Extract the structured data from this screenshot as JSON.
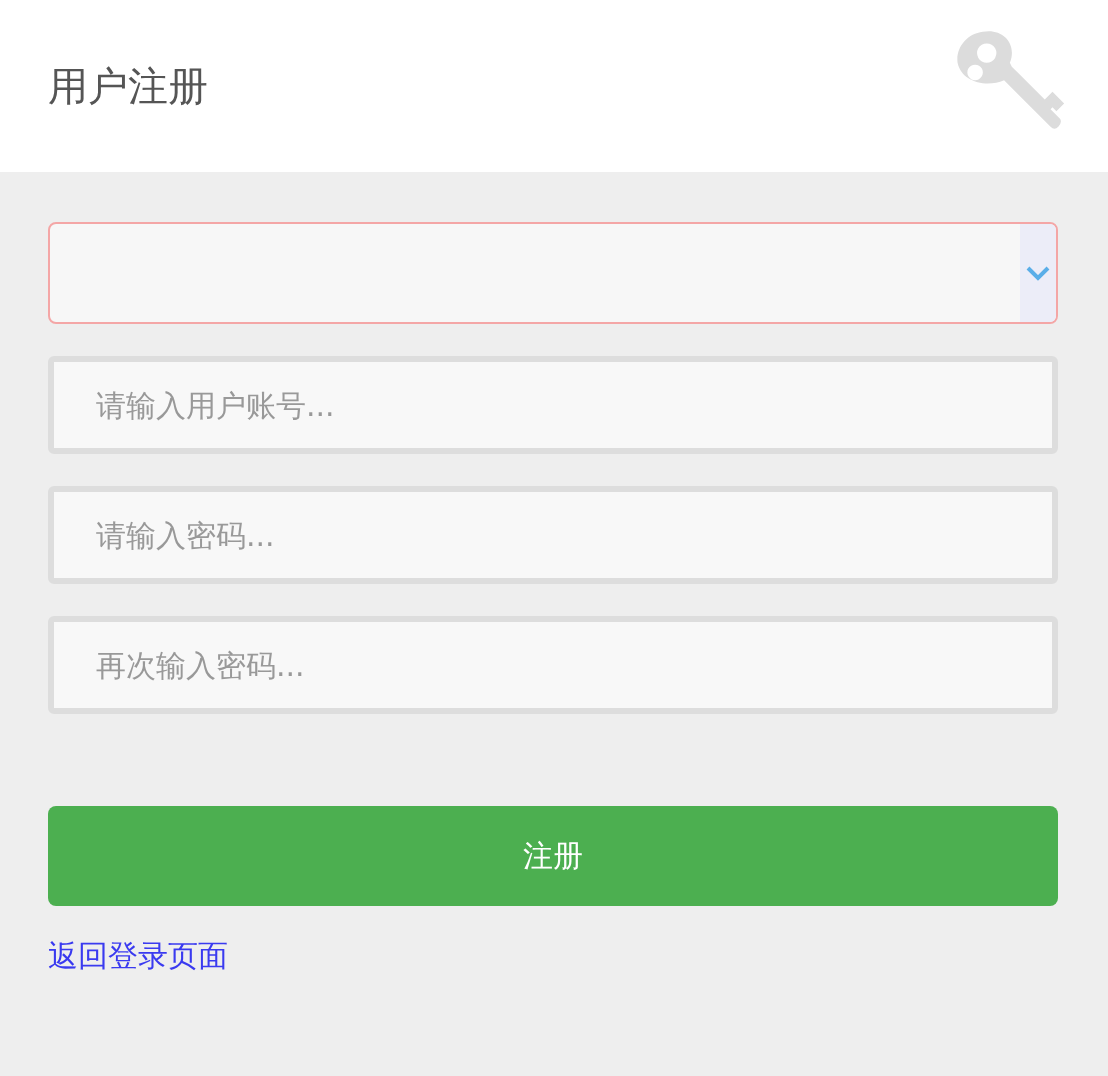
{
  "title": "用户注册",
  "select": {
    "invalid": true
  },
  "fields": [
    {
      "placeholder": "请输入用户账号..."
    },
    {
      "placeholder": "请输入密码..."
    },
    {
      "placeholder": "再次输入密码..."
    }
  ],
  "submit": "注册",
  "link": "返回登录页面"
}
